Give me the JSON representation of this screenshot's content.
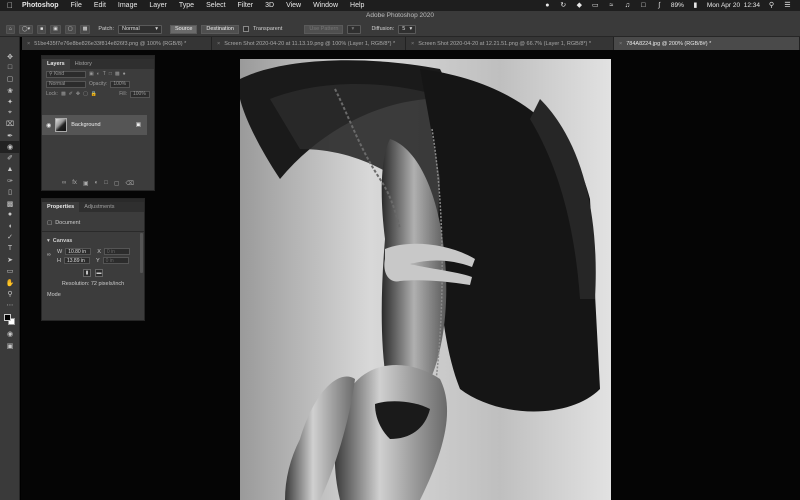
{
  "menubar": {
    "app_name": "Photoshop",
    "items": [
      "File",
      "Edit",
      "Image",
      "Layer",
      "Type",
      "Select",
      "Filter",
      "3D",
      "View",
      "Window",
      "Help"
    ],
    "battery": "89%",
    "datetime": "Mon Apr 20  12:34"
  },
  "window": {
    "title": "Adobe Photoshop 2020"
  },
  "options": {
    "patch_label": "Patch:",
    "patch_mode": "Normal",
    "source_label": "Source",
    "destination_label": "Destination",
    "transparent_label": "Transparent",
    "use_pattern_label": "Use Pattern",
    "diffusion_label": "Diffusion:",
    "diffusion_value": "5"
  },
  "tabs": [
    {
      "label": "51be435f7e76e8be826e33f814e826f3.png @ 100% (RGB/8) *"
    },
    {
      "label": "Screen Shot 2020-04-20 at 11.13.19.png @ 100% (Layer 1, RGB/8*) *"
    },
    {
      "label": "Screen Shot 2020-04-20 at 12.21.51.png @ 66.7% (Layer 1, RGB/8*) *"
    },
    {
      "label": "784A8224.jpg @ 200% (RGB/8#) *"
    }
  ],
  "layers_panel": {
    "tab_layers": "Layers",
    "tab_history": "History",
    "kind_placeholder": "Kind",
    "blend_mode": "Normal",
    "opacity_label": "Opacity:",
    "opacity_value": "100%",
    "lock_label": "Lock:",
    "fill_label": "Fill:",
    "fill_value": "100%",
    "layer_name": "Background"
  },
  "properties_panel": {
    "tab_properties": "Properties",
    "tab_adjustments": "Adjustments",
    "document_label": "Document",
    "canvas_label": "Canvas",
    "w_label": "W",
    "w_value": "10.80 in",
    "h_label": "H",
    "h_value": "13.89 in",
    "x_label": "X",
    "x_value": "0 in",
    "y_label": "Y",
    "y_value": "0 in",
    "resolution": "Resolution: 72 pixels/inch",
    "mode_label": "Mode"
  },
  "icons": {
    "tools": [
      "move-icon",
      "artboard-icon",
      "marquee-icon",
      "lasso-icon",
      "quick-select-icon",
      "crop-icon",
      "frame-icon",
      "eyedropper-icon",
      "patch-icon",
      "brush-icon",
      "clone-stamp-icon",
      "history-brush-icon",
      "eraser-icon",
      "gradient-icon",
      "blur-icon",
      "dodge-icon",
      "pen-icon",
      "type-icon",
      "path-select-icon",
      "rectangle-icon",
      "hand-icon",
      "zoom-icon"
    ]
  }
}
